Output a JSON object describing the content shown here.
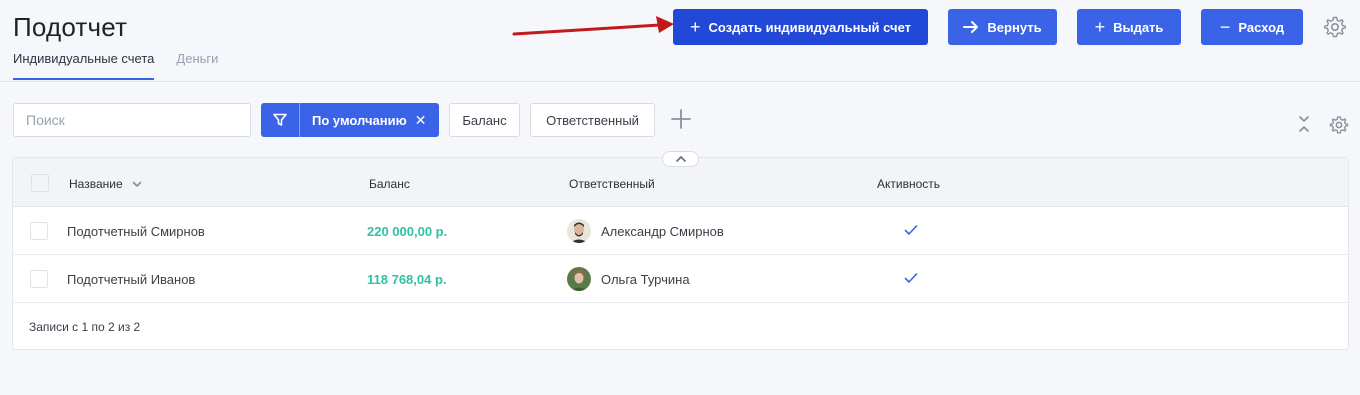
{
  "header": {
    "title": "Подотчет",
    "tabs": [
      {
        "label": "Индивидуальные счета",
        "active": true
      },
      {
        "label": "Деньги",
        "active": false
      }
    ],
    "actions": {
      "create_label": "Создать индивидуальный счет",
      "return_label": "Вернуть",
      "issue_label": "Выдать",
      "expense_label": "Расход"
    }
  },
  "filters": {
    "search_placeholder": "Поиск",
    "active_filter": "По умолчанию",
    "chips": [
      "Баланс",
      "Ответственный"
    ]
  },
  "table": {
    "columns": [
      "Название",
      "Баланс",
      "Ответственный",
      "Активность"
    ],
    "rows": [
      {
        "name": "Подотчетный Смирнов",
        "balance": "220 000,00 р.",
        "responsible": "Александр Смирнов",
        "active": true
      },
      {
        "name": "Подотчетный Иванов",
        "balance": "118 768,04 р.",
        "responsible": "Ольга Турчина",
        "active": true
      }
    ],
    "footer": "Записи с 1 по 2 из 2"
  },
  "colors": {
    "accent": "#3b63e8",
    "primary_button": "#2148d6",
    "balance_text": "#2fc2a3",
    "annotation_arrow": "#c01a1a"
  }
}
